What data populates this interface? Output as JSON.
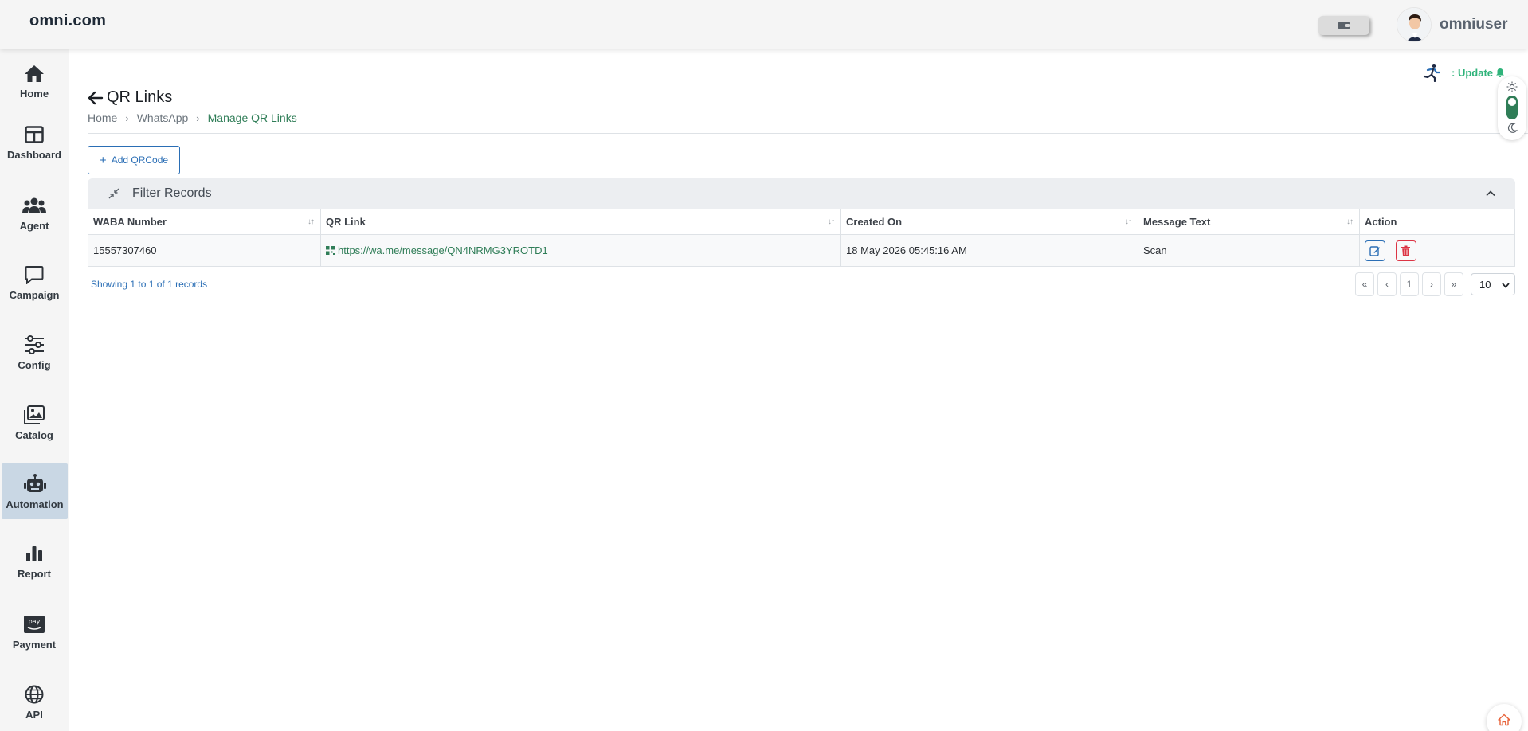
{
  "header": {
    "brand": "omni.com",
    "username": "omniuser"
  },
  "sidebar": {
    "items": [
      {
        "label": "Home",
        "icon": "home-icon"
      },
      {
        "label": "Dashboard",
        "icon": "dashboard-icon"
      },
      {
        "label": "Agent",
        "icon": "agent-icon"
      },
      {
        "label": "Campaign",
        "icon": "campaign-icon"
      },
      {
        "label": "Config",
        "icon": "config-icon"
      },
      {
        "label": "Catalog",
        "icon": "catalog-icon"
      },
      {
        "label": "Automation",
        "icon": "automation-icon",
        "active": true
      },
      {
        "label": "Report",
        "icon": "report-icon"
      },
      {
        "label": "Payment",
        "icon": "payment-icon"
      },
      {
        "label": "API",
        "icon": "api-icon"
      }
    ]
  },
  "page": {
    "title": "QR Links",
    "breadcrumb": [
      "Home",
      "WhatsApp",
      "Manage QR Links"
    ],
    "update_label": ": Update"
  },
  "toolbar": {
    "add_label": "Add QRCode"
  },
  "filter": {
    "title": "Filter Records"
  },
  "table": {
    "columns": [
      "WABA Number",
      "QR Link",
      "Created On",
      "Message Text",
      "Action"
    ],
    "rows": [
      {
        "waba_number": "15557307460",
        "qr_link": "https://wa.me/message/QN4NRMG3YROTD1",
        "created_on": "18 May 2026 05:45:16 AM",
        "message_text": "Scan"
      }
    ]
  },
  "pagination": {
    "summary": "Showing 1 to 1 of 1 records",
    "first": "«",
    "prev": "‹",
    "current": "1",
    "next": "›",
    "last": "»",
    "page_size": "10"
  },
  "colors": {
    "accent_green": "#2f7d57",
    "accent_blue": "#2a6eb5",
    "danger": "#dc3545",
    "sidebar_active": "#c9d7e4"
  }
}
